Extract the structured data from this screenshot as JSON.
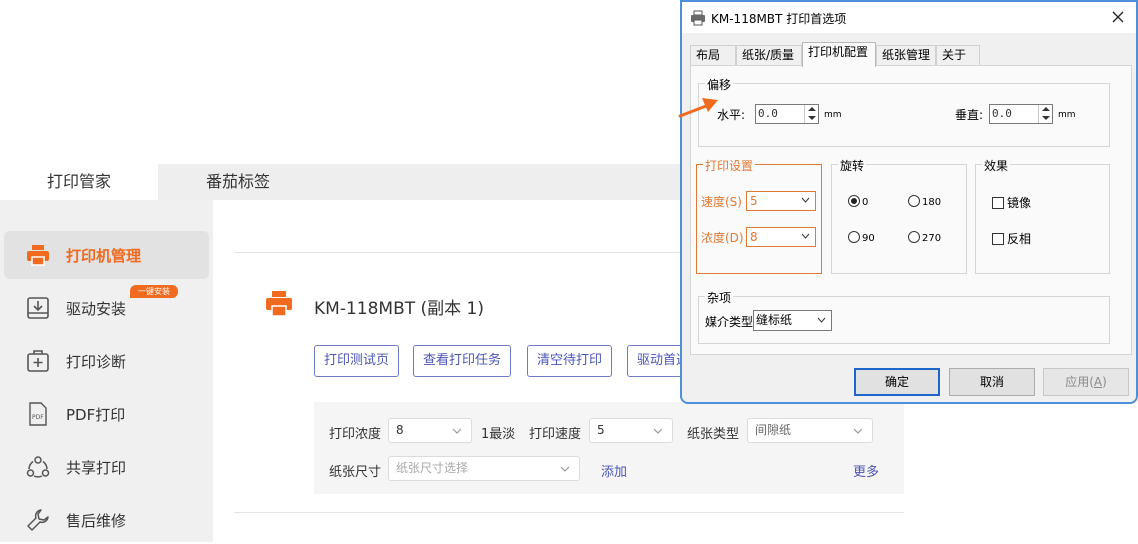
{
  "app": {
    "tabs": [
      {
        "label": "打印管家"
      },
      {
        "label": "番茄标签"
      }
    ],
    "sidebar": {
      "items": [
        {
          "label": "打印机管理",
          "icon": "printer-icon"
        },
        {
          "label": "驱动安装",
          "icon": "driver-install-icon",
          "badge": "一键安装"
        },
        {
          "label": "打印诊断",
          "icon": "diagnosis-icon"
        },
        {
          "label": "PDF打印",
          "icon": "pdf-icon",
          "icon_text": "PDF"
        },
        {
          "label": "共享打印",
          "icon": "share-icon"
        },
        {
          "label": "售后维修",
          "icon": "wrench-icon"
        }
      ]
    },
    "printer_name": "KM-118MBT (副本 1)",
    "actions": [
      "打印测试页",
      "查看打印任务",
      "清空待打印",
      "驱动首选项"
    ],
    "settings": {
      "density_label": "打印浓度",
      "density_value": "8",
      "density_hint": "1最淡",
      "speed_label": "打印速度",
      "speed_value": "5",
      "paper_type_label": "纸张类型",
      "paper_type_value": "间隙纸",
      "paper_size_label": "纸张尺寸",
      "paper_size_placeholder": "纸张尺寸选择",
      "add_link": "添加",
      "more_link": "更多"
    },
    "accent_color": "#f06a1f",
    "link_color": "#4a56b4"
  },
  "dialog": {
    "title": "KM-118MBT 打印首选项",
    "tabs": [
      "布局",
      "纸张/质量",
      "打印机配置",
      "纸张管理",
      "关于"
    ],
    "active_tab": "打印机配置",
    "offset": {
      "title": "偏移",
      "horizontal_label": "水平:",
      "horizontal_value": "0.0",
      "vertical_label": "垂直:",
      "vertical_value": "0.0",
      "unit": "mm"
    },
    "print_settings": {
      "title": "打印设置",
      "speed_label": "速度(S)",
      "speed_value": "5",
      "density_label": "浓度(D)",
      "density_value": "8"
    },
    "rotation": {
      "title": "旋转",
      "options": [
        "0",
        "180",
        "90",
        "270"
      ],
      "selected": "0"
    },
    "effects": {
      "title": "效果",
      "mirror_label": "镜像",
      "invert_label": "反相"
    },
    "misc": {
      "title": "杂项",
      "media_type_label": "媒介类型",
      "media_type_value": "缝标纸"
    },
    "buttons": {
      "ok": "确定",
      "cancel": "取消",
      "apply": "应用(A)",
      "apply_main": "应用(",
      "apply_key": "A",
      "apply_end": ")"
    },
    "highlight_color": "#e07934"
  }
}
